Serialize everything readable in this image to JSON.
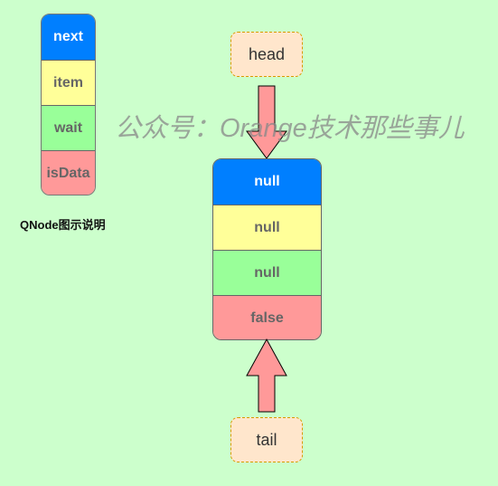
{
  "legend": {
    "caption": "QNode图示说明",
    "fields": [
      {
        "label": "next",
        "color": "#007fff"
      },
      {
        "label": "item",
        "color": "#ffff99"
      },
      {
        "label": "wait",
        "color": "#99ff99"
      },
      {
        "label": "isData",
        "color": "#ff9999"
      }
    ]
  },
  "watermark": "公众号：Orange技术那些事儿",
  "pointers": {
    "head": "head",
    "tail": "tail"
  },
  "node": {
    "fields": [
      {
        "name": "next",
        "value": "null"
      },
      {
        "name": "item",
        "value": "null"
      },
      {
        "name": "wait",
        "value": "null"
      },
      {
        "name": "isData",
        "value": "false"
      }
    ]
  },
  "colors": {
    "background": "#ccffcc",
    "arrow_fill": "#ff9999",
    "pointer_fill": "#ffe6cc",
    "pointer_border": "#d79b00"
  }
}
